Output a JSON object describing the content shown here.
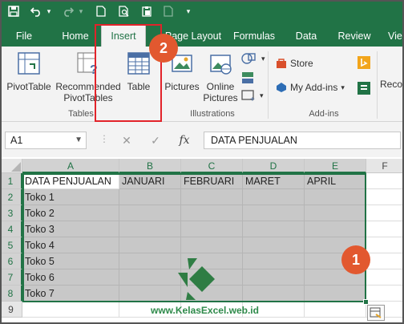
{
  "tabs": [
    {
      "label": "File",
      "active": false
    },
    {
      "label": "Home",
      "active": false
    },
    {
      "label": "Insert",
      "active": true
    },
    {
      "label": "Page Layout",
      "active": false
    },
    {
      "label": "Formulas",
      "active": false
    },
    {
      "label": "Data",
      "active": false
    },
    {
      "label": "Review",
      "active": false
    },
    {
      "label": "Vie",
      "active": false
    }
  ],
  "ribbon": {
    "pivot_table": "PivotTable",
    "recommended_1": "Recommended",
    "recommended_2": "PivotTables",
    "table": "Table",
    "tables_group": "Tables",
    "pictures": "Pictures",
    "online_pictures_1": "Online",
    "online_pictures_2": "Pictures",
    "illustrations_group": "Illustrations",
    "store": "Store",
    "my_addins": "My Add-ins",
    "addins_group": "Add-ins",
    "reco": "Reco"
  },
  "formula_bar": {
    "name_box": "A1",
    "fx": "fx",
    "value": "DATA PENJUALAN"
  },
  "columns": [
    "A",
    "B",
    "C",
    "D",
    "E",
    "F"
  ],
  "rows": [
    "1",
    "2",
    "3",
    "4",
    "5",
    "6",
    "7",
    "8",
    "9"
  ],
  "header_row": [
    "DATA PENJUALAN",
    "JANUARI",
    "FEBRUARI",
    "MARET",
    "APRIL"
  ],
  "stores": [
    "Toko 1",
    "Toko 2",
    "Toko 3",
    "Toko 4",
    "Toko 5",
    "Toko 6",
    "Toko 7"
  ],
  "callouts": {
    "one": "1",
    "two": "2"
  },
  "watermark": "www.KelasExcel.web.id",
  "colors": {
    "excel_green": "#217346",
    "callout": "#e2582f",
    "highlight": "#e2232a",
    "selection_fill": "#c8c8c8"
  }
}
